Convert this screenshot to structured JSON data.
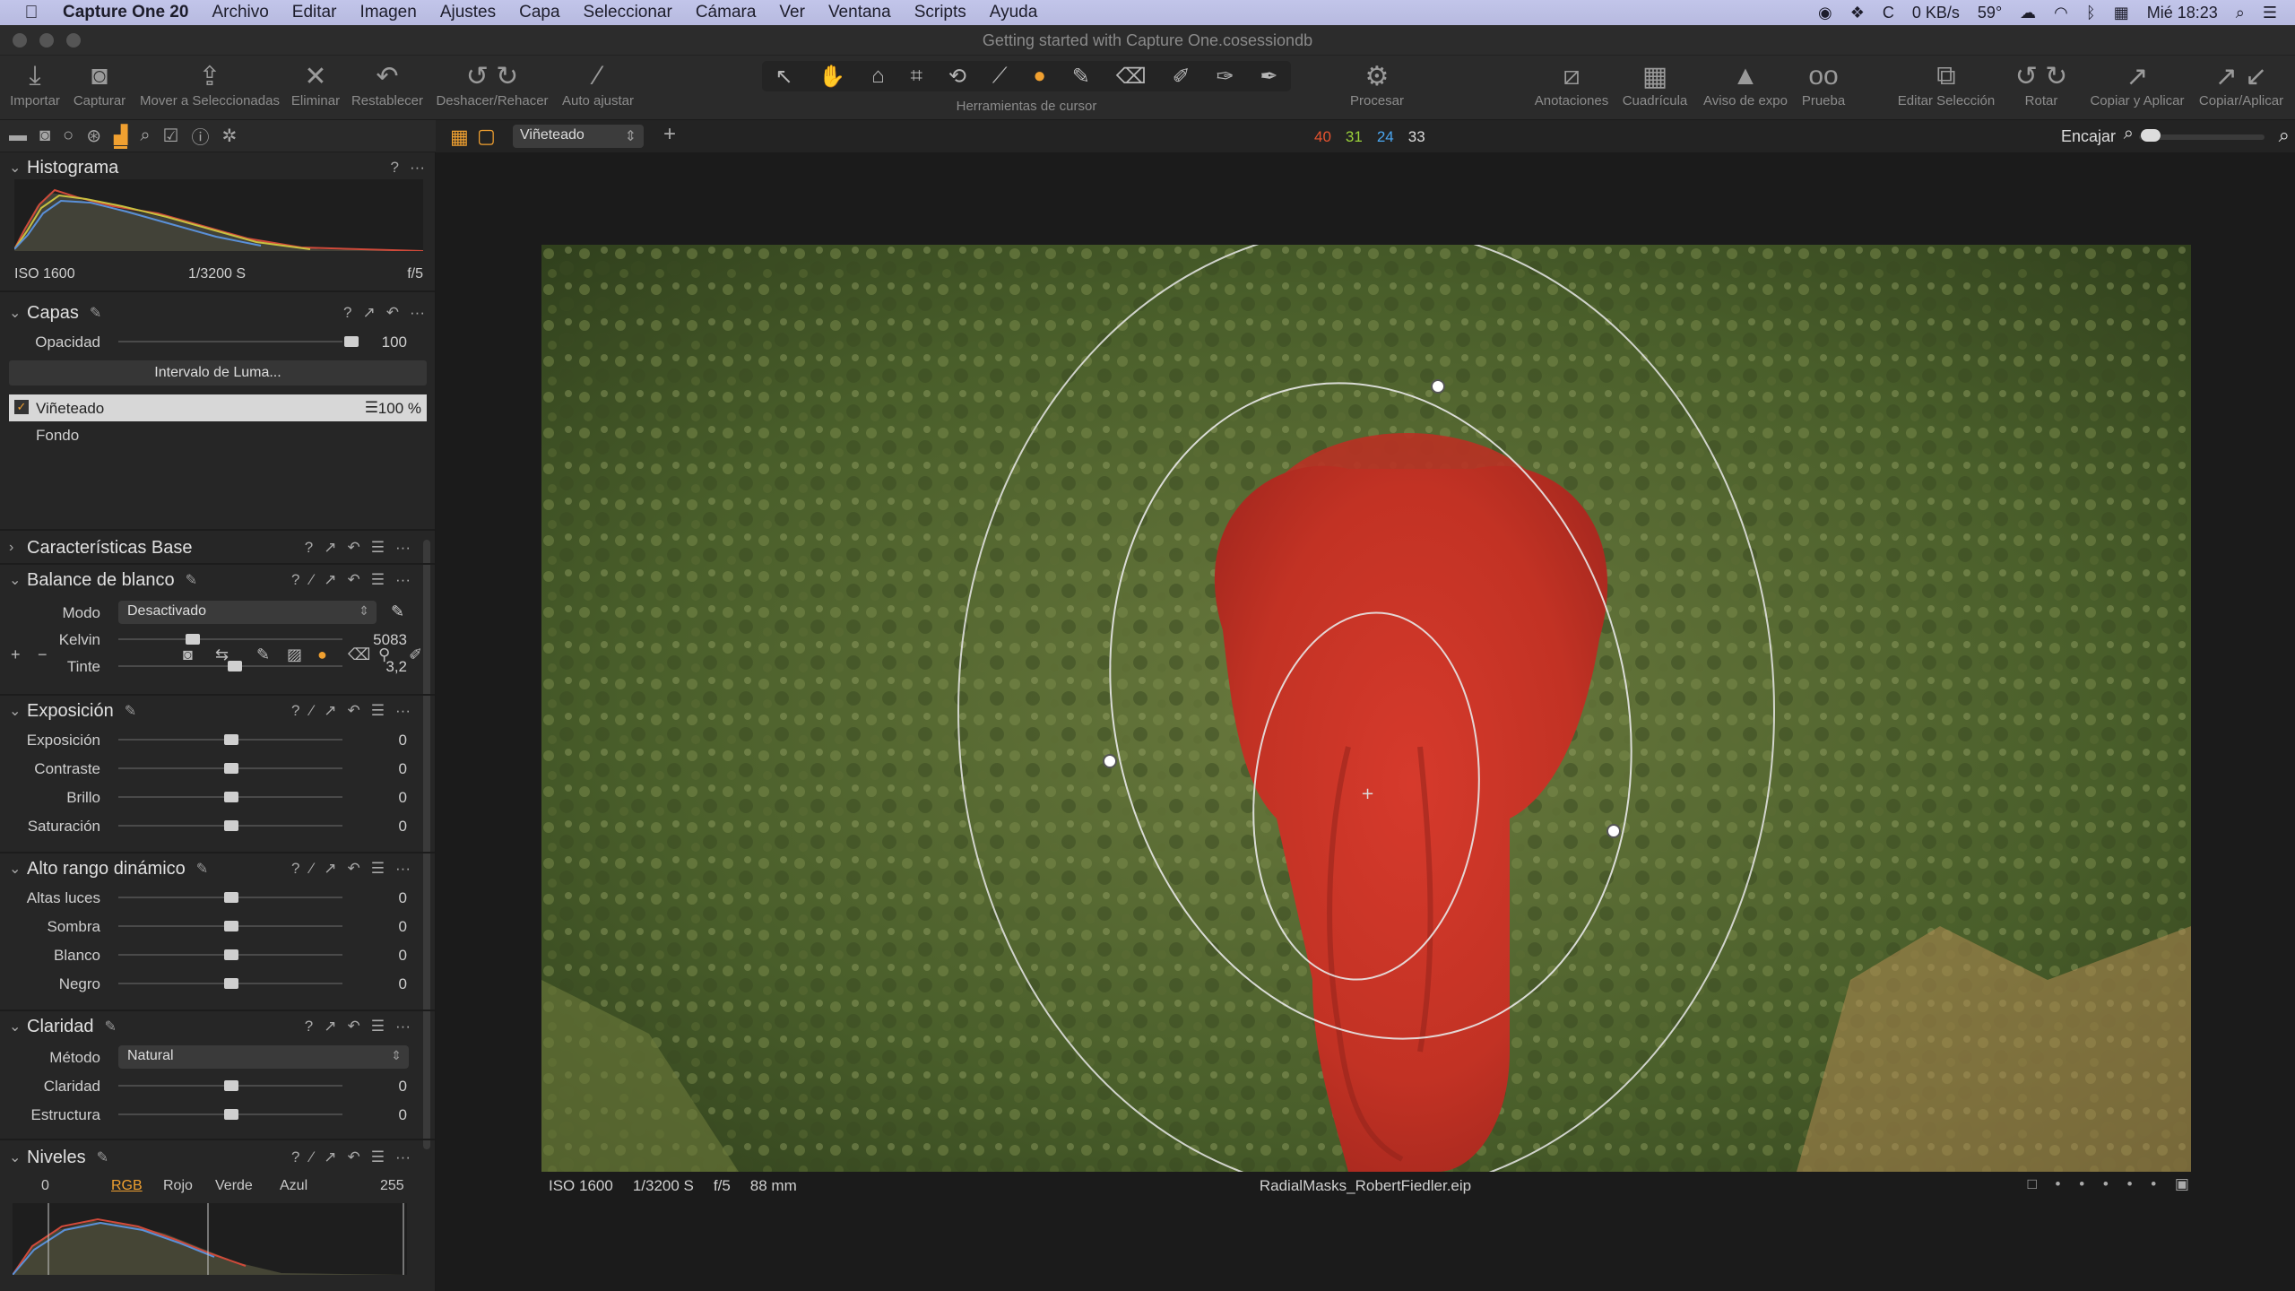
{
  "menubar": {
    "app": "Capture One 20",
    "items": [
      "Archivo",
      "Editar",
      "Imagen",
      "Ajustes",
      "Capa",
      "Seleccionar",
      "Cámara",
      "Ver",
      "Ventana",
      "Scripts",
      "Ayuda"
    ],
    "status": {
      "network": "0 KB/s",
      "temp": "59°",
      "clock": "Mié 18:23"
    }
  },
  "window": {
    "title": "Getting started with Capture One.cosessiondb"
  },
  "toolbar": {
    "import": "Importar",
    "capture": "Capturar",
    "move": "Mover a Seleccionadas",
    "delete": "Eliminar",
    "reset": "Restablecer",
    "undo_redo": "Deshacer/Rehacer",
    "auto_adjust": "Auto ajustar",
    "cursor_tools": "Herramientas de cursor",
    "process": "Procesar",
    "annotations": "Anotaciones",
    "grid": "Cuadrícula",
    "exposure_warning": "Aviso de expo",
    "proof": "Prueba",
    "edit_selection": "Editar Selección",
    "rotate": "Rotar",
    "copy_apply": "Copiar y Aplicar",
    "copy_apply2": "Copiar/Aplicar"
  },
  "viewerbar": {
    "variant": "Viñeteado",
    "counts": [
      {
        "value": "40",
        "color": "#e5532f"
      },
      {
        "value": "31",
        "color": "#9ad13a"
      },
      {
        "value": "24",
        "color": "#4aa6f0"
      },
      {
        "value": "33",
        "color": "#dcdcdc"
      }
    ],
    "fit": "Encajar"
  },
  "histogram": {
    "title": "Histograma",
    "iso": "ISO 1600",
    "shutter": "1/3200 S",
    "aperture": "f/5"
  },
  "layers": {
    "title": "Capas",
    "opacity_label": "Opacidad",
    "opacity": "100",
    "luma_button": "Intervalo de Luma...",
    "items": [
      {
        "name": "Viñeteado",
        "amount": "100 %",
        "checked": true
      },
      {
        "name": "Fondo"
      }
    ]
  },
  "base": {
    "title": "Características Base"
  },
  "white_balance": {
    "title": "Balance de blanco",
    "mode_label": "Modo",
    "mode": "Desactivado",
    "kelvin_label": "Kelvin",
    "kelvin": "5083",
    "kelvin_pos": 0.33,
    "tint_label": "Tinte",
    "tint": "3,2",
    "tint_pos": 0.52
  },
  "exposure": {
    "title": "Exposición",
    "rows": [
      {
        "label": "Exposición",
        "value": "0"
      },
      {
        "label": "Contraste",
        "value": "0"
      },
      {
        "label": "Brillo",
        "value": "0"
      },
      {
        "label": "Saturación",
        "value": "0"
      }
    ]
  },
  "hdr": {
    "title": "Alto rango dinámico",
    "rows": [
      {
        "label": "Altas luces",
        "value": "0"
      },
      {
        "label": "Sombra",
        "value": "0"
      },
      {
        "label": "Blanco",
        "value": "0"
      },
      {
        "label": "Negro",
        "value": "0"
      }
    ]
  },
  "clarity": {
    "title": "Claridad",
    "method_label": "Método",
    "method": "Natural",
    "rows": [
      {
        "label": "Claridad",
        "value": "0"
      },
      {
        "label": "Estructura",
        "value": "0"
      }
    ]
  },
  "levels": {
    "title": "Niveles",
    "low": "0",
    "high": "255",
    "tabs": [
      "RGB",
      "Rojo",
      "Verde",
      "Azul"
    ]
  },
  "image": {
    "iso": "ISO 1600",
    "shutter": "1/3200 S",
    "aperture": "f/5",
    "focal": "88 mm",
    "filename": "RadialMasks_RobertFiedler.eip"
  }
}
